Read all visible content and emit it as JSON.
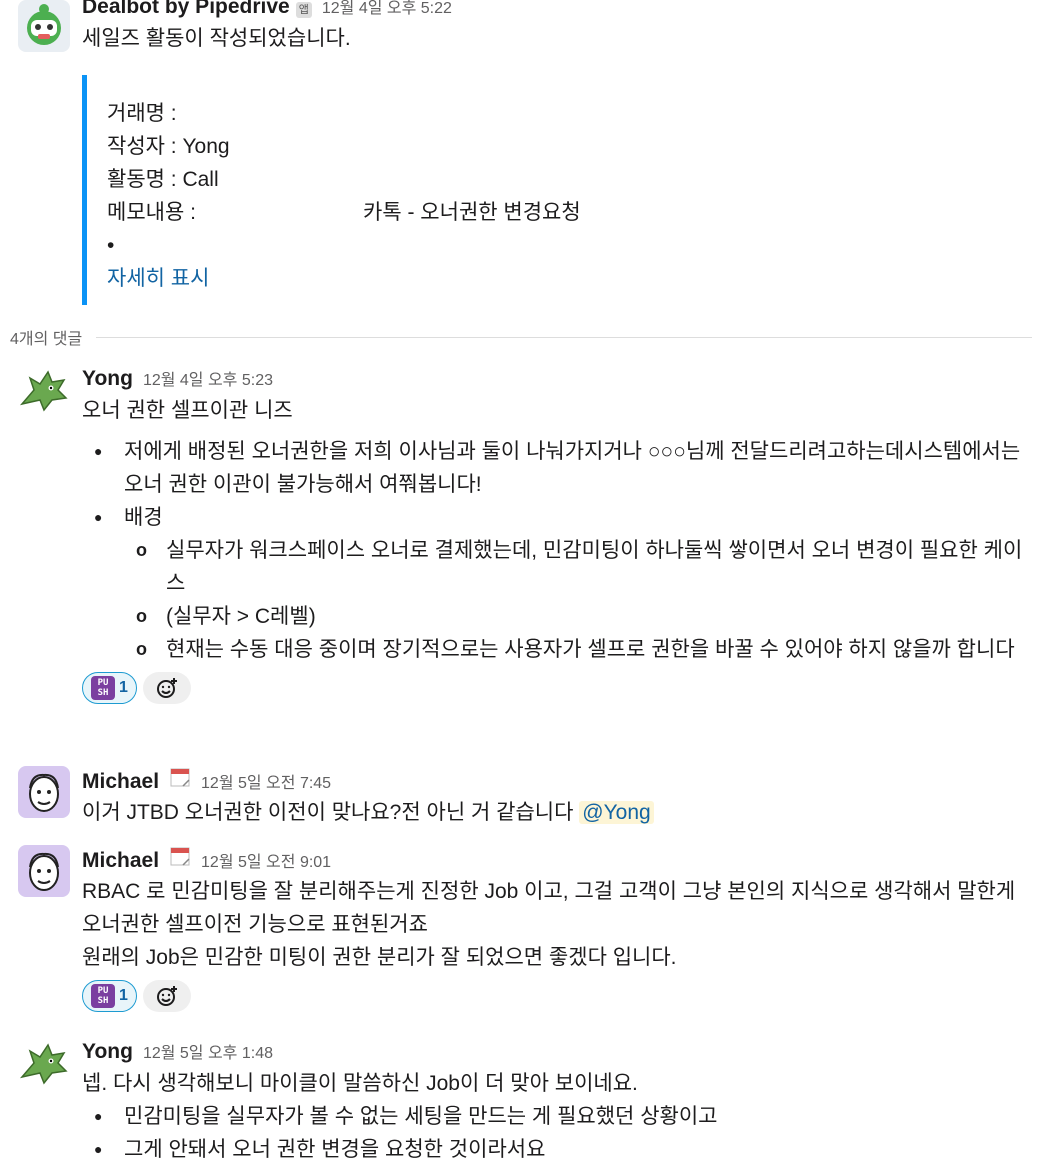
{
  "bot_message": {
    "sender": "Dealbot by Pipedrive",
    "app_tag": "앱",
    "time": "12월 4일 오후 5:22",
    "text": "세일즈 활동이 작성되었습니다.",
    "attachment": {
      "rows": [
        {
          "label": "거래명 :",
          "value": ""
        },
        {
          "label": "작성자 : Yong",
          "value": ""
        },
        {
          "label": "활동명 : Call",
          "value": ""
        },
        {
          "label": "메모내용 :",
          "value": "카톡 - 오너권한 변경요청"
        }
      ],
      "bullet": "•",
      "show_more": "자세히 표시"
    }
  },
  "replies_label": "4개의 댓글",
  "messages": [
    {
      "sender": "Yong",
      "time": "12월 4일 오후 5:23",
      "text": "오너 권한 셀프이관 니즈",
      "bullets": [
        "저에게 배정된 오너권한을  저희 이사님과 둘이 나눠가지거나 ○○○님께 전달드리려고하는데시스템에서는 오너 권한 이관이 불가능해서 여쭤봅니다!",
        "배경"
      ],
      "sub_bullets": [
        "실무자가 워크스페이스 오너로 결제했는데, 민감미팅이 하나둘씩 쌓이면서 오너 변경이 필요한 케이스",
        "(실무자 > C레벨)",
        "현재는 수동 대응 중이며 장기적으로는 사용자가 셀프로 권한을 바꿀 수 있어야 하지 않을까 합니다"
      ],
      "reaction_label": "PU SH",
      "reaction_count": "1"
    },
    {
      "sender": "Michael",
      "time": "12월 5일 오전 7:45",
      "text": "이거 JTBD 오너권한 이전이 맞나요?전 아닌 거 같습니다",
      "mention": "@Yong"
    },
    {
      "sender": "Michael",
      "time": "12월 5일 오전 9:01",
      "text1": "RBAC 로 민감미팅을 잘 분리해주는게 진정한 Job 이고, 그걸 고객이 그냥 본인의 지식으로 생각해서 말한게 오너권한 셀프이전 기능으로 표현된거죠",
      "text2": "원래의 Job은 민감한 미팅이 권한 분리가 잘 되었으면 좋겠다 입니다.",
      "reaction_label": "PU SH",
      "reaction_count": "1"
    },
    {
      "sender": "Yong",
      "time": "12월 5일 오후 1:48",
      "text": "넵. 다시 생각해보니 마이클이 말씀하신 Job이 더 맞아 보이네요.",
      "bullets": [
        "민감미팅을 실무자가 볼 수 없는 세팅을 만드는 게 필요했던 상황이고",
        "그게 안돼서 오너 권한 변경을 요청한 것이라서요"
      ]
    }
  ]
}
